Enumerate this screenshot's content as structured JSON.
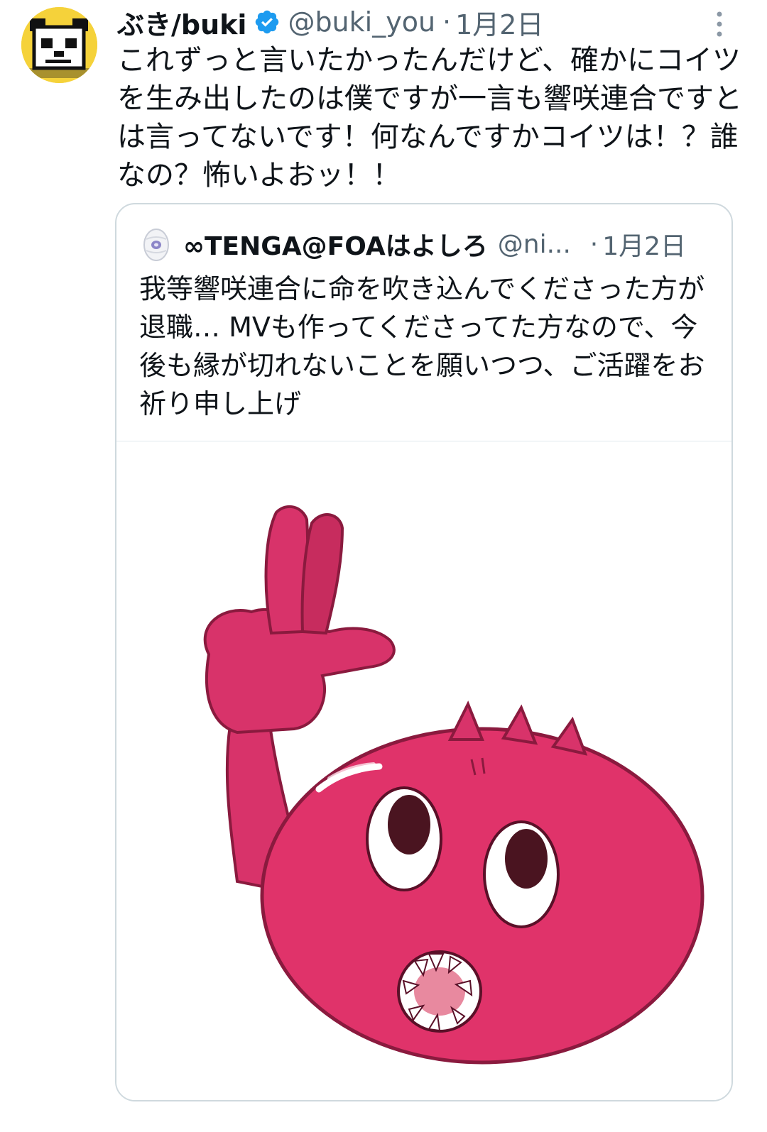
{
  "tweet": {
    "display_name": "ぶき/buki",
    "handle": "@buki_you",
    "separator": "·",
    "date": "1月2日",
    "text": "これずっと言いたかったんだけど、確かにコイツを生み出したのは僕ですが一言も響咲連合ですとは言ってないです！何なんですかコイツは！？誰なの？怖いよおッ！！",
    "avatar_icon": "pixel-panda-avatar",
    "verified_icon": "verified-badge-icon",
    "more_icon": "more-options-icon"
  },
  "quoted_tweet": {
    "display_name": "∞TENGA@FOAはよしろ",
    "handle": "@ni...",
    "separator": "·",
    "date": "1月2日",
    "text": "我等響咲連合に命を吹き込んでくださった方が退職… MVも作ってくださってた方なので、今後も縁が切れないことを願いつつ、ご活躍をお祈り申し上げ",
    "avatar_icon": "egg-avatar",
    "media": "pink-blob-character-image"
  },
  "colors": {
    "text_primary": "#0f1419",
    "text_secondary": "#536471",
    "verified_blue": "#1d9bf0",
    "border": "#cfd9de",
    "character_pink": "#e0336a"
  }
}
